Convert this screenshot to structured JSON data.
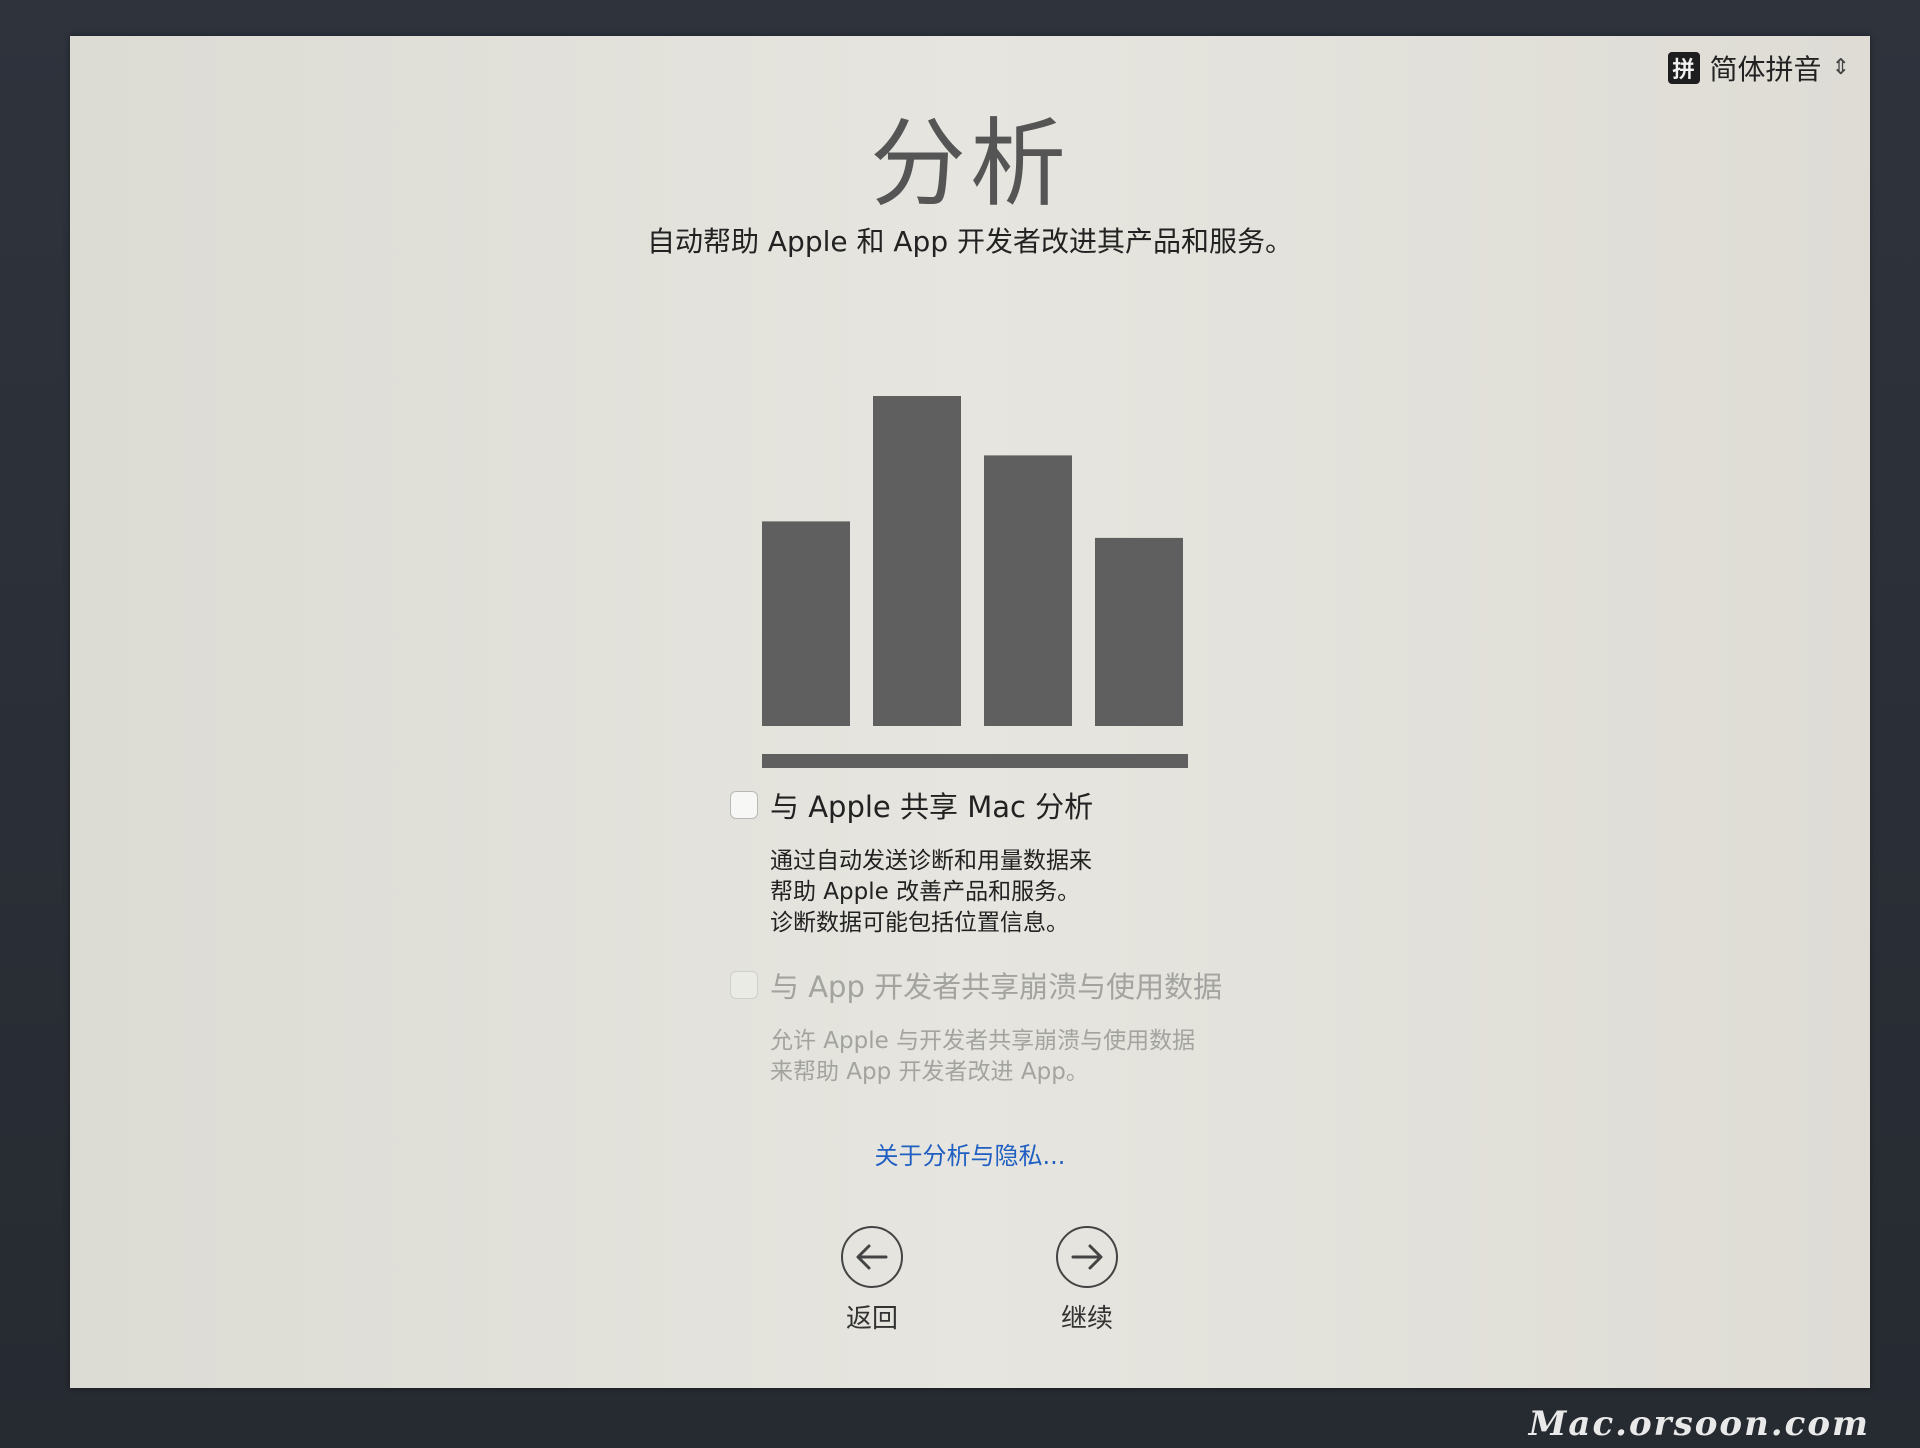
{
  "input_menu": {
    "badge": "拼",
    "label": "简体拼音",
    "icon": "updown-chevron-icon"
  },
  "header": {
    "title": "分析",
    "subtitle": "自动帮助 Apple 和 App 开发者改进其产品和服务。"
  },
  "illustration": {
    "icon": "bar-chart-icon",
    "bar_levels": [
      0.62,
      1.0,
      0.82,
      0.57
    ],
    "color": "#5f5f5f"
  },
  "options": [
    {
      "label": "与 Apple 共享 Mac 分析",
      "checked": false,
      "enabled": true,
      "description": [
        "通过自动发送诊断和用量数据来",
        "帮助 Apple 改善产品和服务。",
        "诊断数据可能包括位置信息。"
      ]
    },
    {
      "label": "与 App 开发者共享崩溃与使用数据",
      "checked": false,
      "enabled": false,
      "description": [
        "允许 Apple 与开发者共享崩溃与使用数据",
        "来帮助 App 开发者改进 App。"
      ]
    }
  ],
  "links": {
    "privacy": "关于分析与隐私..."
  },
  "navigation": {
    "back_label": "返回",
    "continue_label": "继续"
  },
  "watermark": "Mac.orsoon.com",
  "colors": {
    "link": "#1f5fc2",
    "bar": "#5f5f5f",
    "background": "#e3e2dc"
  }
}
